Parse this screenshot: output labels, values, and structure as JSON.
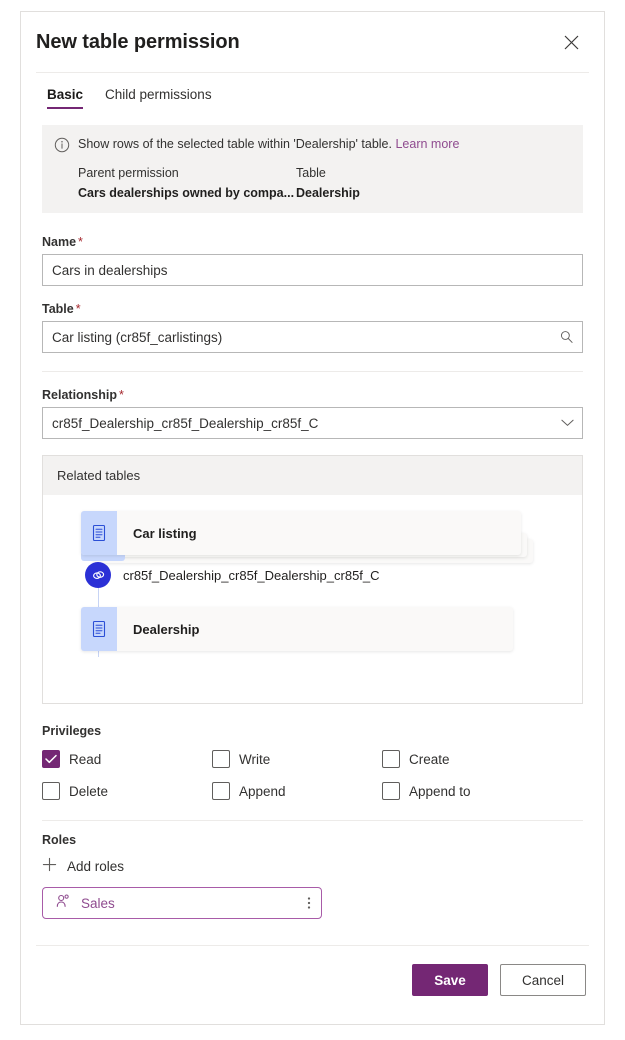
{
  "panel": {
    "title": "New table permission",
    "close_icon": "close-icon"
  },
  "tabs": [
    {
      "label": "Basic",
      "active": true
    },
    {
      "label": "Child permissions",
      "active": false
    }
  ],
  "info_banner": {
    "icon": "info-icon",
    "message": "Show rows of the selected table within 'Dealership' table.",
    "learn_more": "Learn more",
    "columns": [
      "Parent permission",
      "Table"
    ],
    "values": [
      "Cars dealerships owned by compa...",
      "Dealership"
    ]
  },
  "fields": {
    "name": {
      "label": "Name",
      "required": "*",
      "value": "Cars in dealerships",
      "placeholder": ""
    },
    "table": {
      "label": "Table",
      "required": "*",
      "value": "Car listing (cr85f_carlistings)",
      "placeholder": "",
      "icon": "search-icon"
    },
    "relationship": {
      "label": "Relationship",
      "required": "*",
      "value": "cr85f_Dealership_cr85f_Dealership_cr85f_C",
      "placeholder": "",
      "icon": "chevron-down-icon"
    }
  },
  "related_tables": {
    "header": "Related tables",
    "nodes": [
      {
        "type": "table",
        "label": "Car listing",
        "icon": "table-icon"
      },
      {
        "type": "relationship",
        "label": "cr85f_Dealership_cr85f_Dealership_cr85f_C",
        "icon": "link-icon"
      },
      {
        "type": "table",
        "label": "Dealership",
        "icon": "table-icon"
      }
    ]
  },
  "privileges": {
    "label": "Privileges",
    "items": [
      {
        "label": "Read",
        "checked": true
      },
      {
        "label": "Write",
        "checked": false
      },
      {
        "label": "Create",
        "checked": false
      },
      {
        "label": "Delete",
        "checked": false
      },
      {
        "label": "Append",
        "checked": false
      },
      {
        "label": "Append to",
        "checked": false
      }
    ]
  },
  "roles": {
    "label": "Roles",
    "add_label": "Add roles",
    "add_icon": "plus-icon",
    "chips": [
      {
        "name": "Sales",
        "icon": "person-icon",
        "menu_icon": "more-vertical-icon"
      }
    ]
  },
  "footer": {
    "save_label": "Save",
    "cancel_label": "Cancel"
  },
  "colors": {
    "accent": "#742774",
    "link": "#8f4b8f",
    "required": "#a4262c",
    "node_icon_bg": "#c7d7fc",
    "relationship_circle": "#2b30d6",
    "banner_bg": "#f3f2f1"
  }
}
